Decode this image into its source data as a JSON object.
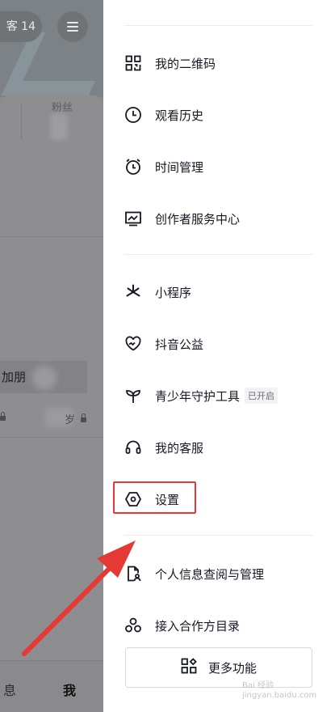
{
  "background_profile": {
    "visitor_button": "客 14",
    "fans_label": "粉丝",
    "add_friend_label": "加朋",
    "age_tag": "岁",
    "tabs": {
      "messages": "息",
      "me": "我"
    }
  },
  "drawer": {
    "menu": [
      {
        "label": "我的二维码",
        "icon": "qr-code-icon"
      },
      {
        "label": "观看历史",
        "icon": "clock-icon"
      },
      {
        "label": "时间管理",
        "icon": "alarm-clock-icon"
      },
      {
        "label": "创作者服务中心",
        "icon": "chart-monitor-icon"
      },
      {
        "label": "小程序",
        "icon": "mini-program-icon"
      },
      {
        "label": "抖音公益",
        "icon": "charity-heart-icon"
      },
      {
        "label": "青少年守护工具",
        "icon": "sprout-icon",
        "badge": "已开启"
      },
      {
        "label": "我的客服",
        "icon": "headset-icon"
      },
      {
        "label": "设置",
        "icon": "hexagon-settings-icon",
        "highlighted": true
      },
      {
        "label": "个人信息查阅与管理",
        "icon": "personal-info-icon"
      },
      {
        "label": "接入合作方目录",
        "icon": "partners-icon"
      }
    ],
    "more_button": {
      "label": "更多功能",
      "icon": "grid-more-icon"
    }
  },
  "watermark": {
    "line1": "Bai 经验",
    "line2": "jingyan.baidu.com"
  },
  "colors": {
    "annotation": "#e53935",
    "overlay": "#8a8a8c",
    "text": "#161823"
  }
}
